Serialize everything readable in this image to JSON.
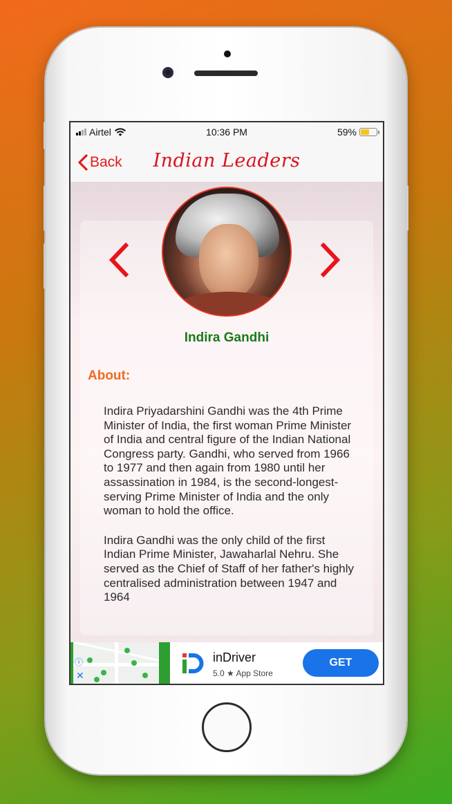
{
  "status_bar": {
    "carrier": "Airtel",
    "time": "10:36 PM",
    "battery": "59%",
    "battery_level": 0.59
  },
  "nav": {
    "back_label": "Back",
    "title": "Indian Leaders"
  },
  "leader": {
    "name": "Indira Gandhi",
    "about_heading": "About:",
    "paragraphs": [
      "Indira Priyadarshini Gandhi  was the 4th Prime Minister of India, the first woman Prime Minister of India and central figure of the Indian National Congress party. Gandhi, who served from 1966 to 1977 and then again from 1980 until her assassination in 1984, is the second-longest-serving Prime Minister of India and the only woman to hold the office.",
      "Indira Gandhi was the only child of the first Indian Prime Minister, Jawaharlal Nehru. She served as the Chief of Staff of her father's highly centralised administration between 1947 and 1964"
    ]
  },
  "ad": {
    "app_name": "inDriver",
    "rating": "5.0 ★ App Store",
    "cta": "GET"
  },
  "colors": {
    "accent_red": "#e11b1b",
    "name_green": "#1a7a1a",
    "about_orange": "#f06a1e",
    "cta_blue": "#1a73e8"
  },
  "icons": [
    "signal-icon",
    "wifi-icon",
    "battery-icon",
    "chevron-left-icon",
    "prev-arrow-icon",
    "next-arrow-icon",
    "ad-info-icon",
    "ad-close-icon",
    "indriver-logo-icon"
  ]
}
